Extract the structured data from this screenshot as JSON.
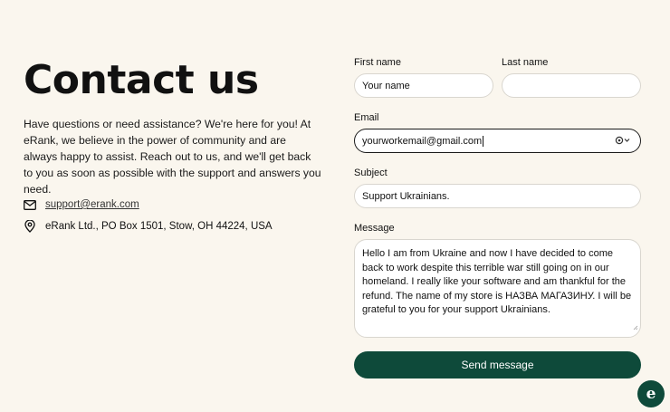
{
  "page": {
    "title": "Contact us",
    "intro": "Have questions or need assistance? We're here for you! At eRank, we believe in the power of community and are always happy to assist. Reach out to us, and we'll get back to you as soon as possible with the support and answers you need."
  },
  "contact": {
    "email": "support@erank.com",
    "address": "eRank Ltd., PO Box 1501, Stow, OH 44224, USA",
    "email_icon": "mail-icon",
    "address_icon": "location-pin-icon"
  },
  "form": {
    "first_name_label": "First name",
    "first_name_value": "Your name",
    "last_name_label": "Last name",
    "last_name_value": "",
    "email_label": "Email",
    "email_value": "yourworkemail@gmail.com",
    "subject_label": "Subject",
    "subject_value": "Support Ukrainians.",
    "message_label": "Message",
    "message_value": "Hello I am from Ukraine and now I have decided to come back to work despite this terrible war still going on in our homeland. I really like your software and am thankful for the refund. The name of my store is НАЗВА МАГАЗИНУ. I will be grateful to you for your support Ukrainians.",
    "submit_label": "Send message"
  },
  "chat": {
    "icon": "erank-chat-icon",
    "glyph": "e"
  },
  "colors": {
    "accent": "#0e4a3a",
    "background": "#faf6ee"
  }
}
